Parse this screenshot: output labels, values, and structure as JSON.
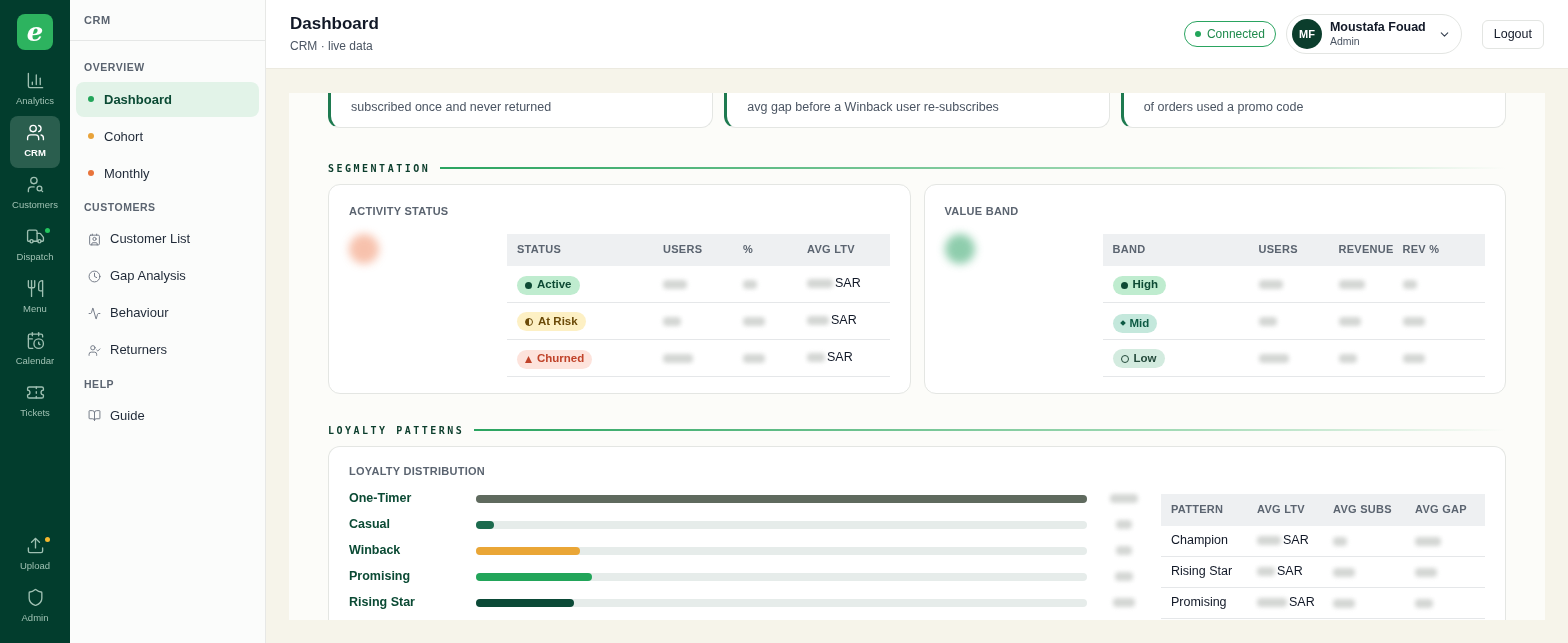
{
  "rail": {
    "logo": "e",
    "items": [
      {
        "label": "Analytics",
        "selected": false
      },
      {
        "label": "CRM",
        "selected": true
      },
      {
        "label": "Customers",
        "selected": false
      },
      {
        "label": "Dispatch",
        "selected": false,
        "color": "#22c55e"
      },
      {
        "label": "Menu",
        "selected": false
      },
      {
        "label": "Calendar",
        "selected": false
      },
      {
        "label": "Tickets",
        "selected": false
      }
    ],
    "bottom_items": [
      {
        "label": "Upload",
        "selected": false,
        "color": "#f5b82e"
      },
      {
        "label": "Admin",
        "selected": false
      }
    ]
  },
  "sidebar": {
    "title": "CRM",
    "sections": [
      {
        "heading": "OVERVIEW",
        "items": [
          {
            "label": "Dashboard",
            "kind": "dot",
            "color": "#22a55a",
            "selected": true
          },
          {
            "label": "Cohort",
            "kind": "dot",
            "color": "#e8a33a",
            "selected": false
          },
          {
            "label": "Monthly",
            "kind": "dot",
            "color": "#e8743b",
            "selected": false
          }
        ]
      },
      {
        "heading": "CUSTOMERS",
        "items": [
          {
            "label": "Customer List",
            "kind": "icon",
            "selected": false
          },
          {
            "label": "Gap Analysis",
            "kind": "icon",
            "selected": false
          },
          {
            "label": "Behaviour",
            "kind": "icon",
            "selected": false
          },
          {
            "label": "Returners",
            "kind": "icon",
            "selected": false
          }
        ]
      },
      {
        "heading": "HELP",
        "items": [
          {
            "label": "Guide",
            "kind": "icon",
            "selected": false
          }
        ]
      }
    ]
  },
  "header": {
    "title": "Dashboard",
    "subtitle": "CRM · live data",
    "status": "Connected",
    "user": {
      "initials": "MF",
      "name": "Moustafa Fouad",
      "role": "Admin"
    },
    "logout": "Logout"
  },
  "kpi_cards": [
    {
      "caption": "subscribed once and never returned"
    },
    {
      "caption": "avg gap before a Winback user re-subscribes"
    },
    {
      "caption": "of orders used a promo code"
    }
  ],
  "segmentation": {
    "heading": "SEGMENTATION",
    "activity_status": {
      "title": "ACTIVITY STATUS",
      "columns": [
        "STATUS",
        "USERS",
        "%",
        "AVG LTV"
      ],
      "rows": [
        {
          "status": "Active",
          "kind": "active",
          "unit": "SAR"
        },
        {
          "status": "At Risk",
          "kind": "at_risk",
          "unit": "SAR"
        },
        {
          "status": "Churned",
          "kind": "churned",
          "unit": "SAR"
        }
      ]
    },
    "value_band": {
      "title": "VALUE BAND",
      "columns": [
        "BAND",
        "USERS",
        "REVENUE",
        "REV %"
      ],
      "rows": [
        {
          "band": "High",
          "kind": "high"
        },
        {
          "band": "Mid",
          "kind": "mid"
        },
        {
          "band": "Low",
          "kind": "low"
        }
      ]
    }
  },
  "loyalty": {
    "heading": "LOYALTY PATTERNS",
    "title": "LOYALTY DISTRIBUTION",
    "bars": [
      {
        "label": "One-Timer",
        "level": 1.0,
        "color": "#5f6a5e"
      },
      {
        "label": "Casual",
        "level": 0.03,
        "color": "#1c6b4e"
      },
      {
        "label": "Winback",
        "level": 0.17,
        "color": "#eaa636"
      },
      {
        "label": "Promising",
        "level": 0.19,
        "color": "#22a55a"
      },
      {
        "label": "Rising Star",
        "level": 0.16,
        "color": "#0b4a37"
      }
    ],
    "table": {
      "columns": [
        "PATTERN",
        "AVG LTV",
        "AVG SUBS",
        "AVG GAP"
      ],
      "rows": [
        {
          "pattern": "Champion",
          "unit": "SAR"
        },
        {
          "pattern": "Rising Star",
          "unit": "SAR"
        },
        {
          "pattern": "Promising",
          "unit": "SAR"
        }
      ]
    }
  }
}
